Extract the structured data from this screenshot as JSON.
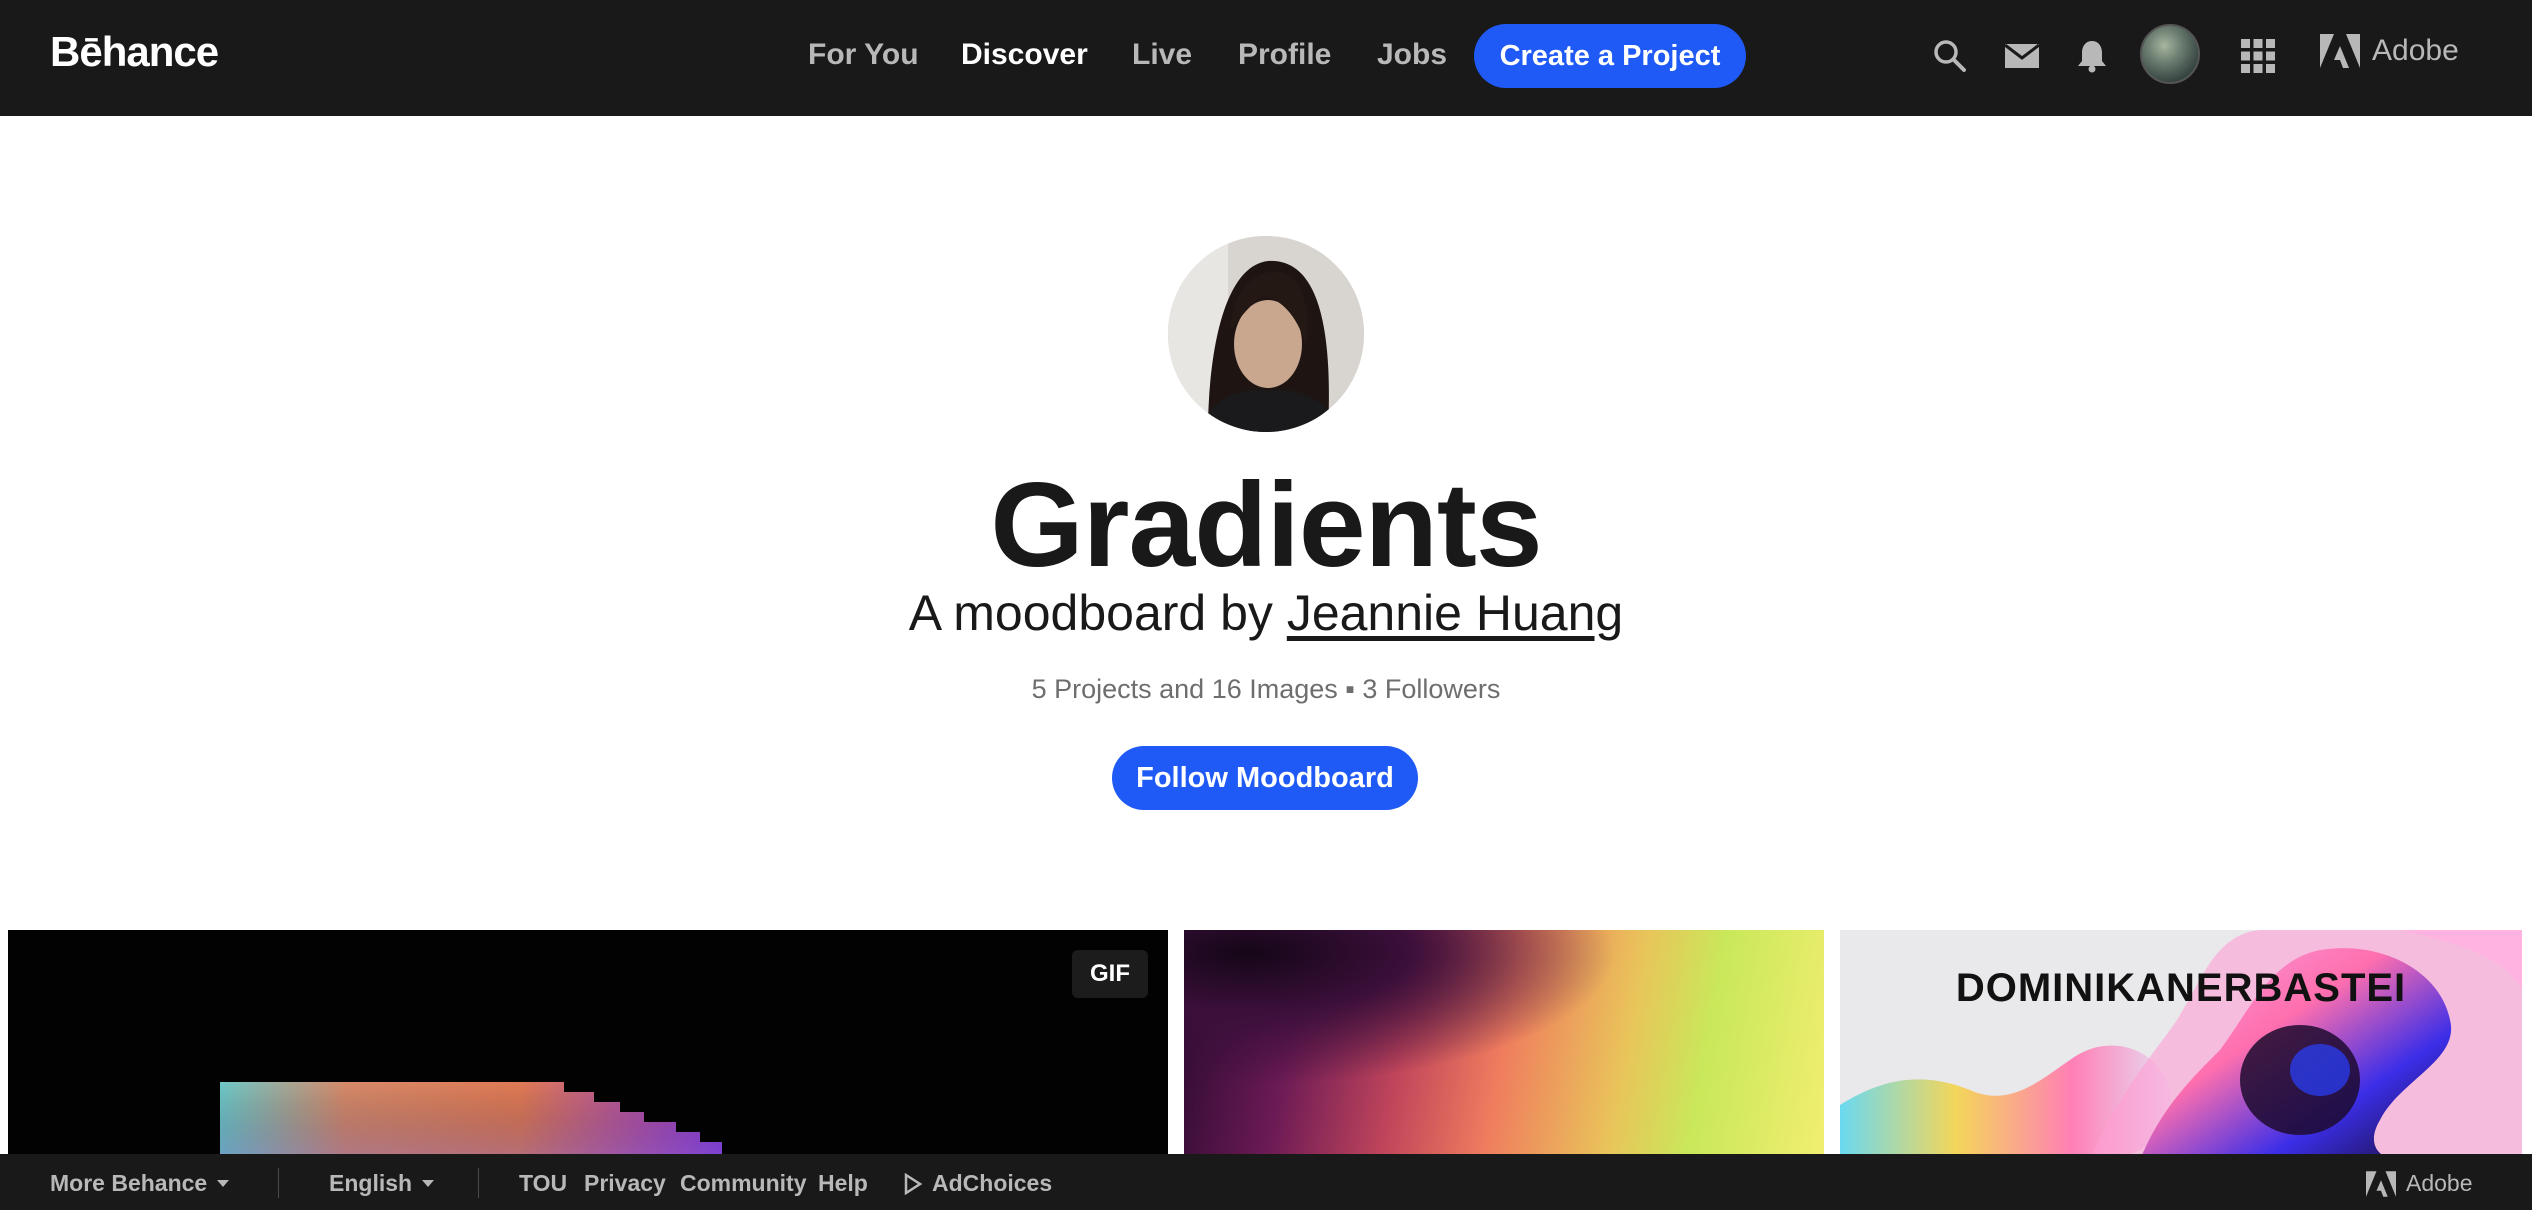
{
  "nav": {
    "logo": "Bēhance",
    "links": [
      "For You",
      "Discover",
      "Live",
      "Profile",
      "Jobs"
    ],
    "active_link": "Discover",
    "create_button": "Create a Project",
    "icons": [
      "search-icon",
      "mail-icon",
      "bell-icon",
      "avatar",
      "apps-grid-icon"
    ],
    "adobe_label": "Adobe"
  },
  "hero": {
    "title": "Gradients",
    "subtitle_prefix": "A moodboard by ",
    "author": "Jeannie Huang",
    "stats": "5 Projects and 16 Images ▪ 3 Followers",
    "follow_button": "Follow Moodboard"
  },
  "tiles": [
    {
      "badge": "GIF"
    },
    {
      "badge": ""
    },
    {
      "text": "DOMINIKANERBASTEI"
    }
  ],
  "footer": {
    "more": "More Behance",
    "language": "English",
    "links": [
      "TOU",
      "Privacy",
      "Community",
      "Help"
    ],
    "adchoices": "AdChoices",
    "adobe_label": "Adobe"
  },
  "colors": {
    "nav_bg": "#191919",
    "accent_blue": "#1f5af6",
    "nav_text": "#b8b8b8",
    "nav_active": "#ffffff"
  }
}
